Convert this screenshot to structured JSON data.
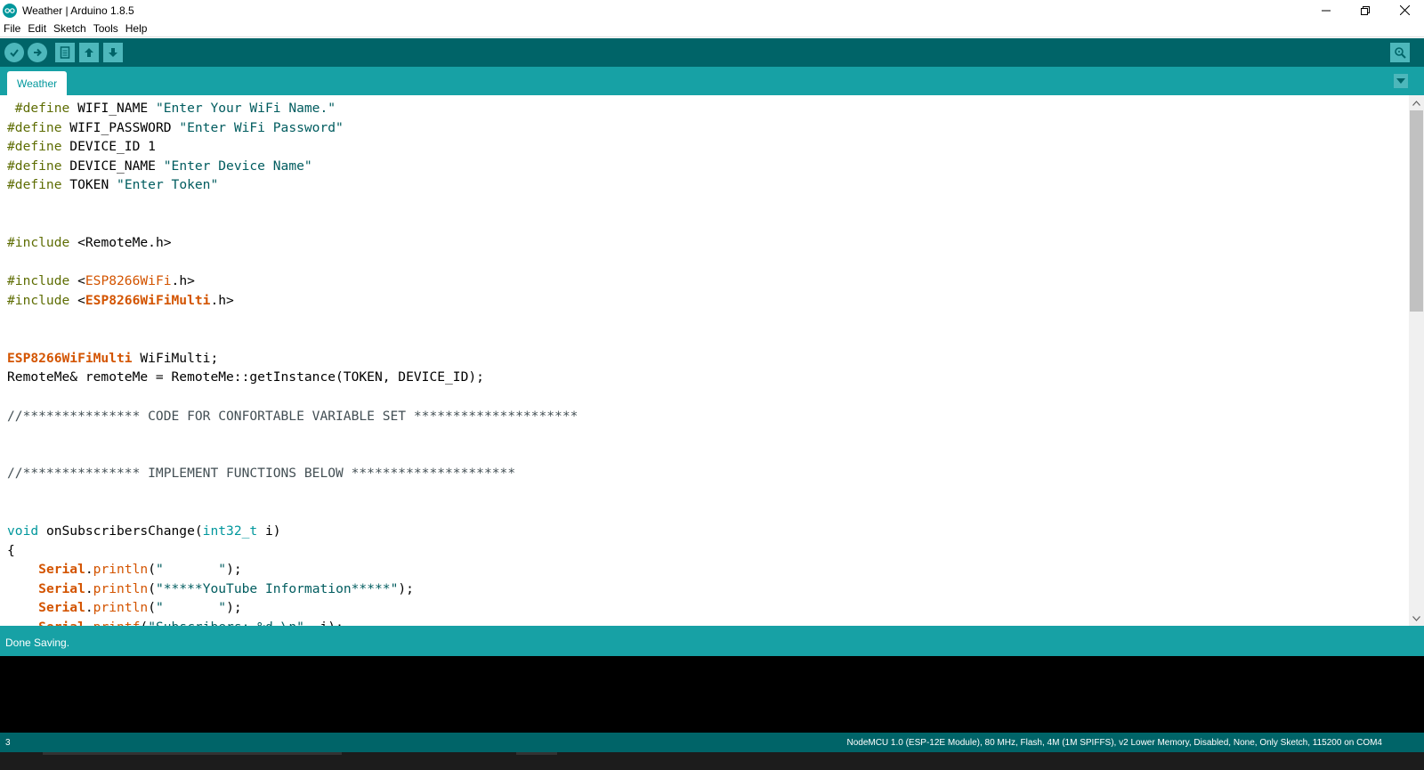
{
  "window": {
    "title": "Weather | Arduino 1.8.5",
    "app_icon": "arduino-logo-icon",
    "controls": [
      "minimize-icon",
      "restore-icon",
      "close-icon"
    ]
  },
  "menu": {
    "items": [
      "File",
      "Edit",
      "Sketch",
      "Tools",
      "Help"
    ]
  },
  "toolbar": {
    "buttons": [
      "verify-icon",
      "upload-icon",
      "new-icon",
      "open-icon",
      "save-icon"
    ],
    "right_button": "serial-monitor-icon"
  },
  "tabs": {
    "active": "Weather",
    "menu_icon": "tab-menu-icon"
  },
  "editor": {
    "lines": [
      [
        [
          " #define",
          "kw-prep"
        ],
        [
          " WIFI_NAME ",
          "plain"
        ],
        [
          "\"Enter Your WiFi Name.\"",
          "str"
        ]
      ],
      [
        [
          "#define",
          "kw-prep"
        ],
        [
          " WIFI_PASSWORD ",
          "plain"
        ],
        [
          "\"Enter WiFi Password\"",
          "str"
        ]
      ],
      [
        [
          "#define",
          "kw-prep"
        ],
        [
          " DEVICE_ID 1",
          "plain"
        ]
      ],
      [
        [
          "#define",
          "kw-prep"
        ],
        [
          " DEVICE_NAME ",
          "plain"
        ],
        [
          "\"Enter Device Name\"",
          "str"
        ]
      ],
      [
        [
          "#define",
          "kw-prep"
        ],
        [
          " TOKEN ",
          "plain"
        ],
        [
          "\"Enter Token\"",
          "str"
        ]
      ],
      [],
      [],
      [
        [
          "#include",
          "kw-prep"
        ],
        [
          " <RemoteMe.h>",
          "plain"
        ]
      ],
      [],
      [
        [
          "#include",
          "kw-prep"
        ],
        [
          " <",
          "plain"
        ],
        [
          "ESP8266WiFi",
          "orange"
        ],
        [
          ".h>",
          "plain"
        ]
      ],
      [
        [
          "#include",
          "kw-prep"
        ],
        [
          " <",
          "plain"
        ],
        [
          "ESP8266WiFiMulti",
          "orange-b"
        ],
        [
          ".h>",
          "plain"
        ]
      ],
      [],
      [],
      [
        [
          "ESP8266WiFiMulti",
          "orange-b"
        ],
        [
          " WiFiMulti;",
          "plain"
        ]
      ],
      [
        [
          "RemoteMe& remoteMe = RemoteMe::getInstance(TOKEN, DEVICE_ID);",
          "plain"
        ]
      ],
      [],
      [
        [
          "//*************** CODE FOR CONFORTABLE VARIABLE SET *********************",
          "comment"
        ]
      ],
      [],
      [],
      [
        [
          "//*************** IMPLEMENT FUNCTIONS BELOW *********************",
          "comment"
        ]
      ],
      [],
      [],
      [
        [
          "void",
          "type"
        ],
        [
          " onSubscribersChange(",
          "plain"
        ],
        [
          "int32_t",
          "type"
        ],
        [
          " i)",
          "plain"
        ]
      ],
      [
        [
          "{",
          "plain"
        ]
      ],
      [
        [
          "    ",
          "plain"
        ],
        [
          "Serial",
          "orange-b"
        ],
        [
          ".",
          "plain"
        ],
        [
          "println",
          "orange"
        ],
        [
          "(",
          "plain"
        ],
        [
          "\"       \"",
          "str"
        ],
        [
          ");",
          "plain"
        ]
      ],
      [
        [
          "    ",
          "plain"
        ],
        [
          "Serial",
          "orange-b"
        ],
        [
          ".",
          "plain"
        ],
        [
          "println",
          "orange"
        ],
        [
          "(",
          "plain"
        ],
        [
          "\"*****YouTube Information*****\"",
          "str"
        ],
        [
          ");",
          "plain"
        ]
      ],
      [
        [
          "    ",
          "plain"
        ],
        [
          "Serial",
          "orange-b"
        ],
        [
          ".",
          "plain"
        ],
        [
          "println",
          "orange"
        ],
        [
          "(",
          "plain"
        ],
        [
          "\"       \"",
          "str"
        ],
        [
          ");",
          "plain"
        ]
      ],
      [
        [
          "    ",
          "plain"
        ],
        [
          "Serial",
          "orange-b"
        ],
        [
          ".",
          "plain"
        ],
        [
          "printf",
          "orange"
        ],
        [
          "(",
          "plain"
        ],
        [
          "\"Subscribers: %d \\n\"",
          "str"
        ],
        [
          ", i);",
          "plain"
        ]
      ]
    ]
  },
  "status": {
    "message": "Done Saving."
  },
  "footer": {
    "line_number": "3",
    "board_info": "NodeMCU 1.0 (ESP-12E Module), 80 MHz, Flash, 4M (1M SPIFFS), v2 Lower Memory, Disabled, None, Only Sketch, 115200 on COM4"
  },
  "colors": {
    "toolbar": "#006468",
    "tabbar": "#17a1a5",
    "accent": "#00979c",
    "preprocessor": "#5e6d03",
    "string": "#005c5f",
    "keyword_orange": "#d35400"
  }
}
